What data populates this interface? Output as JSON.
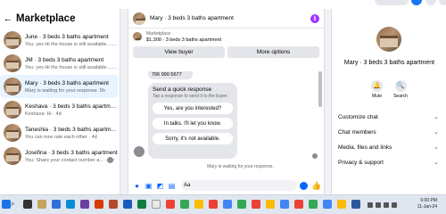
{
  "left": {
    "title": "Marketplace",
    "threads": [
      {
        "name": "June · 3 beds 3 baths apartment",
        "preview": "You: yes Hi the house is still available ... 5h"
      },
      {
        "name": "JM · 3 beds 3 baths apartment",
        "preview": "You: yes Hi the house is still available ... 5h"
      },
      {
        "name": "Mary · 3 beds 3 baths apartment",
        "preview": "Mary is waiting for your response. 5h"
      },
      {
        "name": "Keshava · 3 beds 3 baths apartment",
        "preview": "Keshava: Hi · 4d"
      },
      {
        "name": "Taneshia · 3 beds 3 baths apartment",
        "preview": "You can now rate each other · 4d"
      },
      {
        "name": "Josefina · 3 beds 3 baths apartment",
        "preview": "You: Share your contact number a... · 2w"
      }
    ]
  },
  "chat": {
    "title": "Mary · 3 beds 3 baths apartment",
    "listing_label": "Marketplace",
    "listing_price": "$1,300 · 3 beds 3 baths apartment",
    "view_buyer": "View buyer",
    "more_options": "More options",
    "phone": "706 990 5677",
    "quick_title": "Send a quick response",
    "quick_sub": "Tap a response to send it to the buyer.",
    "options": [
      "Yes, are you interested?",
      "In talks. I'll let you know.",
      "Sorry, it's not available."
    ],
    "status": "Mary is waiting for your response.",
    "composer_value": "Aa"
  },
  "right": {
    "title": "Mary · 3 beds 3 baths apartment",
    "mute": "Mute",
    "search": "Search",
    "menu": [
      "Customize chat",
      "Chat members",
      "Media, files and links",
      "Privacy & support"
    ]
  },
  "taskbar": {
    "time": "6:00 PM",
    "date": "11-Jan-24"
  },
  "colors": {
    "accent": "#0866ff",
    "info": "#a033ff",
    "active_thread": "#e7f3ff"
  }
}
